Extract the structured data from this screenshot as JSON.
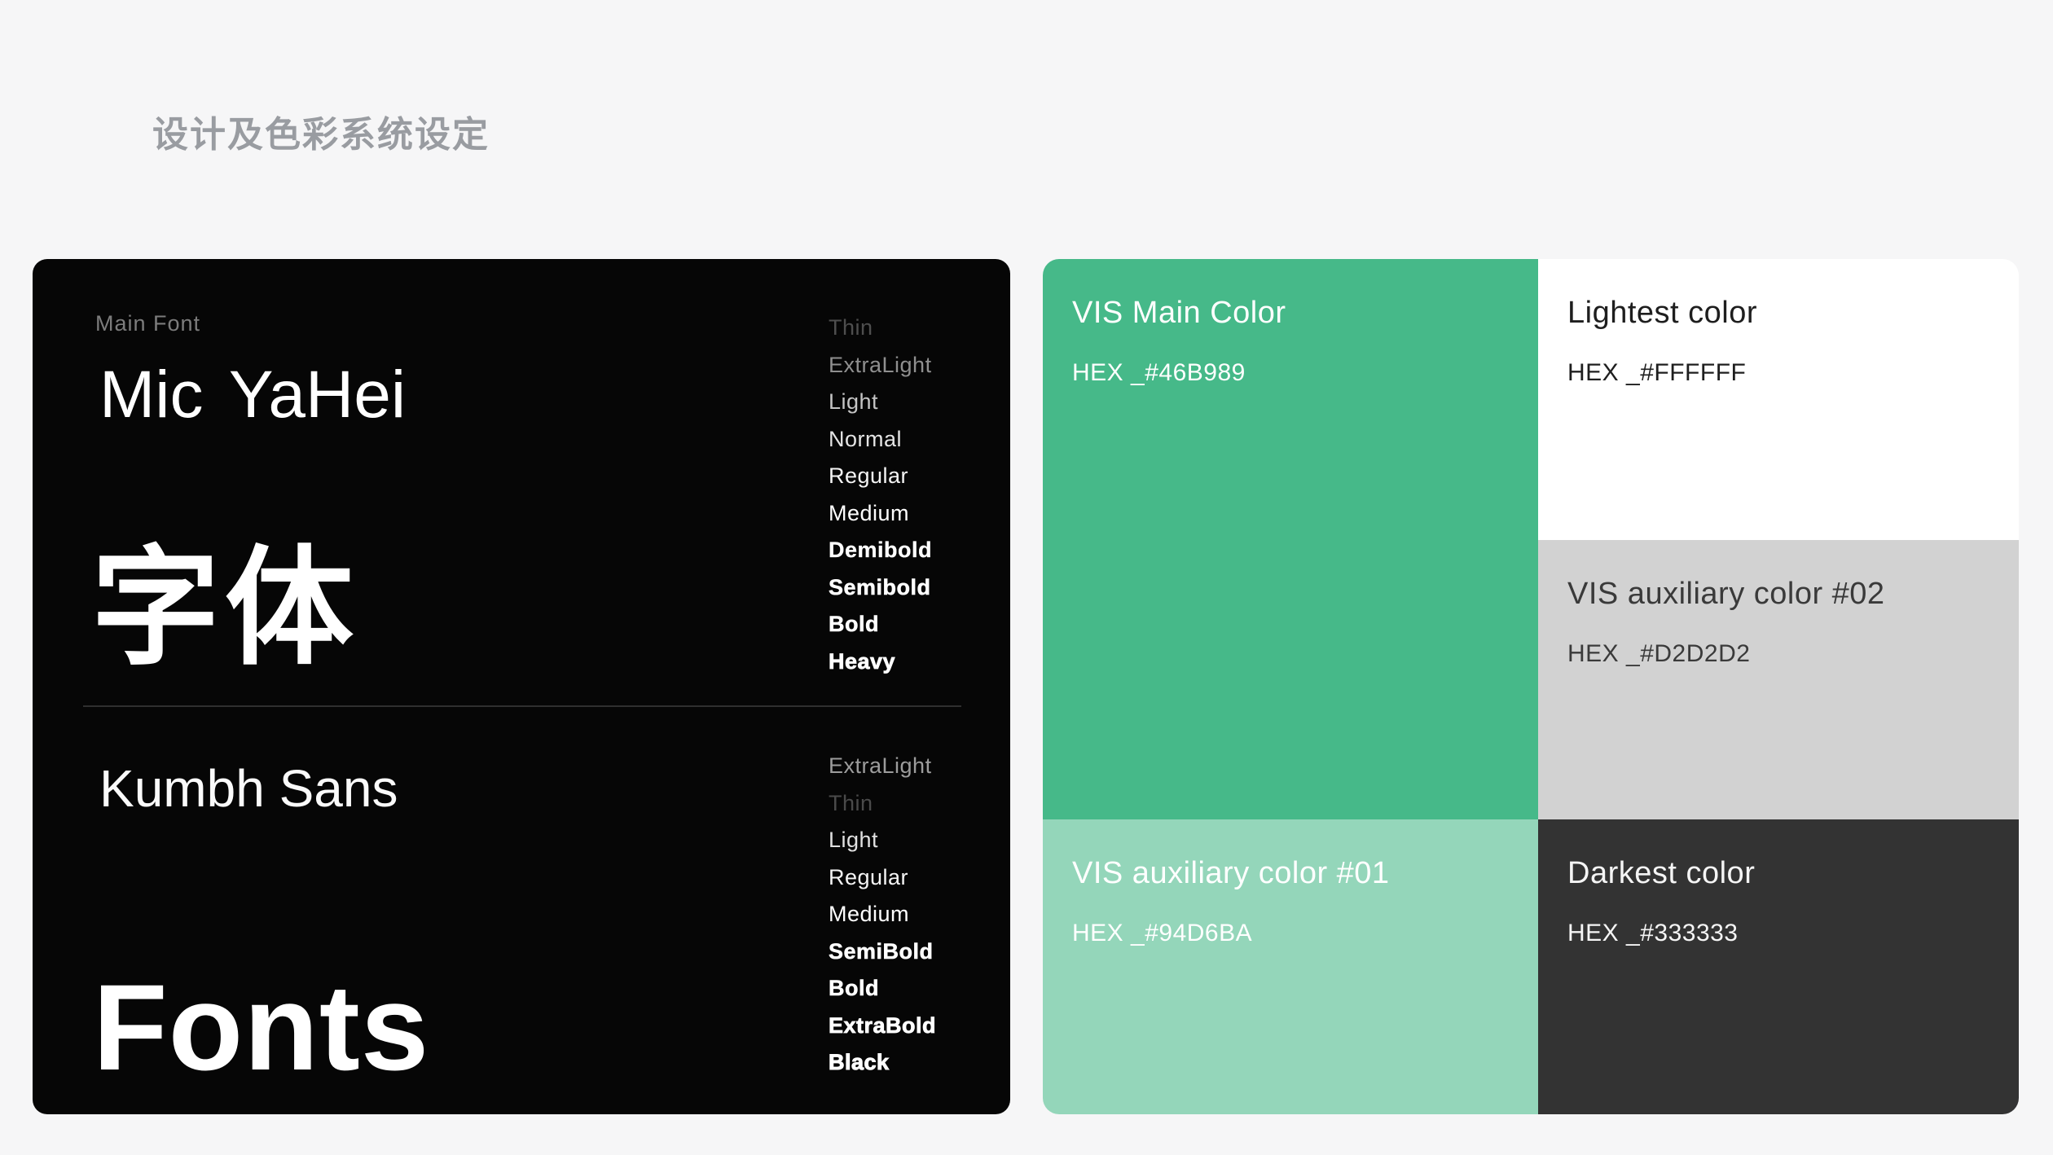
{
  "page": {
    "title": "设计及色彩系统设定",
    "background": "#F6F6F7"
  },
  "font_card": {
    "background": "#060606",
    "section_label": "Main Font",
    "main_font": {
      "name": "Mic YaHei",
      "cjk_specimen": "字体",
      "weights": [
        {
          "label": "Thin",
          "color": "#4E4E4E",
          "weight": 200
        },
        {
          "label": "ExtraLight",
          "color": "#8F8F8F",
          "weight": 300
        },
        {
          "label": "Light",
          "color": "#C4C4C4",
          "weight": 300
        },
        {
          "label": "Normal",
          "color": "#E4E4E4",
          "weight": 400
        },
        {
          "label": "Regular",
          "color": "#F4F4F4",
          "weight": 400
        },
        {
          "label": "Medium",
          "color": "#FFFFFF",
          "weight": 500
        },
        {
          "label": "Demibold",
          "color": "#FFFFFF",
          "weight": 600
        },
        {
          "label": "Semibold",
          "color": "#FFFFFF",
          "weight": 700
        },
        {
          "label": "Bold",
          "color": "#FFFFFF",
          "weight": 700
        },
        {
          "label": "Heavy",
          "color": "#FFFFFF",
          "weight": 800
        }
      ]
    },
    "secondary_font": {
      "name": "Kumbh Sans",
      "latin_specimen": "Fonts",
      "weights": [
        {
          "label": "ExtraLight",
          "color": "#9C9C9C",
          "weight": 300
        },
        {
          "label": "Thin",
          "color": "#4A4A4A",
          "weight": 200
        },
        {
          "label": "Light",
          "color": "#E0E0E0",
          "weight": 300
        },
        {
          "label": "Regular",
          "color": "#F5F5F5",
          "weight": 400
        },
        {
          "label": "Medium",
          "color": "#FFFFFF",
          "weight": 500
        },
        {
          "label": "SemiBold",
          "color": "#FFFFFF",
          "weight": 700
        },
        {
          "label": "Bold",
          "color": "#FFFFFF",
          "weight": 700
        },
        {
          "label": "ExtraBold",
          "color": "#FFFFFF",
          "weight": 800
        },
        {
          "label": "Black",
          "color": "#FFFFFF",
          "weight": 900
        }
      ]
    }
  },
  "color_grid": {
    "swatches": [
      {
        "name": "VIS Main Color",
        "hex_label": "HEX _#46B989",
        "color": "#46B989",
        "text_color": "#FFFFFF"
      },
      {
        "name": "Lightest color",
        "hex_label": "HEX _#FFFFFF",
        "color": "#FFFFFF",
        "text_color": "#1E1E1E"
      },
      {
        "name": "VIS auxiliary color #02",
        "hex_label": "HEX _#D2D2D2",
        "color": "#D2D2D2",
        "text_color": "#3A3A3A"
      },
      {
        "name": "VIS auxiliary color #01",
        "hex_label": "HEX _#94D6BA",
        "color": "#94D6BA",
        "text_color": "#FFFFFF"
      },
      {
        "name": "Darkest color",
        "hex_label": "HEX _#333333",
        "color": "#333333",
        "text_color": "#F5F5F5"
      }
    ]
  }
}
